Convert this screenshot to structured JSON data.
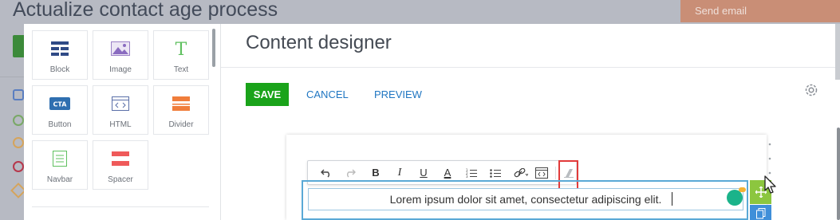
{
  "background": {
    "page_title": "Actualize contact age process",
    "send_email_label": "Send email"
  },
  "palette": {
    "tiles": [
      {
        "label": "Block",
        "icon": "block-icon"
      },
      {
        "label": "Image",
        "icon": "image-icon"
      },
      {
        "label": "Text",
        "icon": "text-icon"
      },
      {
        "label": "Button",
        "icon": "cta-button-icon",
        "icon_text": "CTA"
      },
      {
        "label": "HTML",
        "icon": "html-icon"
      },
      {
        "label": "Divider",
        "icon": "divider-icon"
      },
      {
        "label": "Navbar",
        "icon": "navbar-icon"
      },
      {
        "label": "Spacer",
        "icon": "spacer-icon"
      }
    ]
  },
  "designer": {
    "title": "Content designer",
    "save_label": "SAVE",
    "cancel_label": "CANCEL",
    "preview_label": "PREVIEW"
  },
  "toolbar": {
    "bold_glyph": "B",
    "italic_glyph": "I",
    "underline_glyph": "U",
    "font_color_glyph": "A"
  },
  "editor": {
    "text": "Lorem ipsum dolor sit amet, consectetur adipiscing elit."
  },
  "colors": {
    "save": "#1aa31a",
    "link": "#1f76c2",
    "accent_orange": "#f07d3b",
    "accent_green": "#5fc05f",
    "highlight": "#e23a3a",
    "selection": "#5aa9d6"
  }
}
